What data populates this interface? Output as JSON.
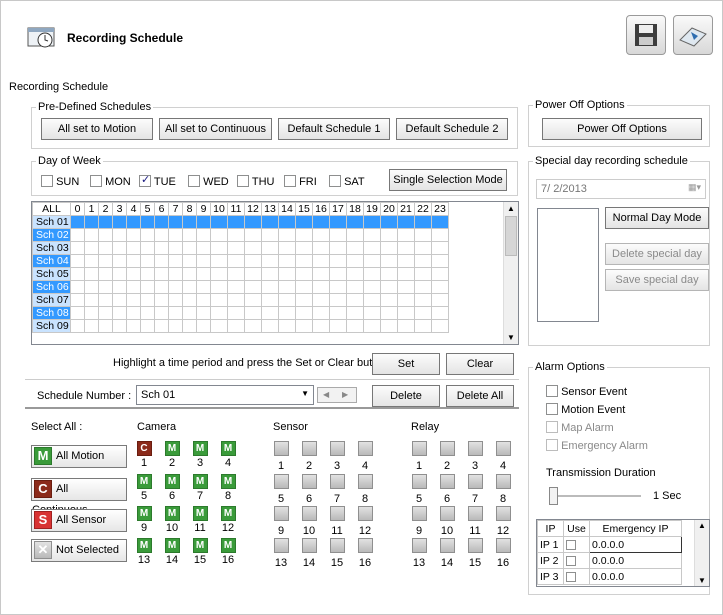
{
  "title": "Recording Schedule",
  "toolbar": {
    "save": "save-icon",
    "apply": "apply-icon"
  },
  "main_group": "Recording Schedule",
  "predefined": {
    "legend": "Pre-Defined Schedules",
    "buttons": [
      "All set to Motion",
      "All set to Continuous",
      "Default Schedule 1",
      "Default Schedule 2"
    ]
  },
  "dow": {
    "legend": "Day of Week",
    "days": [
      {
        "label": "SUN",
        "checked": false
      },
      {
        "label": "MON",
        "checked": false
      },
      {
        "label": "TUE",
        "checked": true
      },
      {
        "label": "WED",
        "checked": false
      },
      {
        "label": "THU",
        "checked": false
      },
      {
        "label": "FRI",
        "checked": false
      },
      {
        "label": "SAT",
        "checked": false
      }
    ],
    "mode_button": "Single Selection Mode"
  },
  "grid": {
    "all": "ALL",
    "hours": [
      "0",
      "1",
      "2",
      "3",
      "4",
      "5",
      "6",
      "7",
      "8",
      "9",
      "10",
      "11",
      "12",
      "13",
      "14",
      "15",
      "16",
      "17",
      "18",
      "19",
      "20",
      "21",
      "22",
      "23"
    ],
    "rows": [
      "Sch 01",
      "Sch 02",
      "Sch 03",
      "Sch 04",
      "Sch 05",
      "Sch 06",
      "Sch 07",
      "Sch 08",
      "Sch 09"
    ],
    "colors": {
      "selected_row": "#3399ff",
      "header_blue": "#5b9bd5"
    }
  },
  "hint": "Highlight a time period and press the Set or Clear button",
  "set_button": "Set",
  "clear_button": "Clear",
  "schedule_number": {
    "label": "Schedule Number :",
    "value": "Sch 01",
    "delete": "Delete",
    "delete_all": "Delete All"
  },
  "select_all": {
    "label": "Select All :",
    "buttons": [
      {
        "badge": "M",
        "label": "All Motion"
      },
      {
        "badge": "C",
        "label": "All Continuous"
      },
      {
        "badge": "S",
        "label": "All Sensor"
      },
      {
        "badge": "✕",
        "label": "Not Selected"
      }
    ]
  },
  "camera": {
    "label": "Camera",
    "badges": [
      "C",
      "M",
      "M",
      "M",
      "M",
      "M",
      "M",
      "M",
      "M",
      "M",
      "M",
      "M",
      "M",
      "M",
      "M",
      "M"
    ]
  },
  "sensor": {
    "label": "Sensor"
  },
  "relay": {
    "label": "Relay"
  },
  "numbers": [
    "1",
    "2",
    "3",
    "4",
    "5",
    "6",
    "7",
    "8",
    "9",
    "10",
    "11",
    "12",
    "13",
    "14",
    "15",
    "16"
  ],
  "power_off": {
    "legend": "Power Off Options",
    "button": "Power Off Options"
  },
  "special_day": {
    "legend": "Special day recording schedule",
    "date": "7/ 2/2013",
    "normal": "Normal Day Mode",
    "delete": "Delete special day",
    "save": "Save special day"
  },
  "alarm": {
    "legend": "Alarm Options",
    "items": [
      {
        "label": "Sensor Event",
        "enabled": true
      },
      {
        "label": "Motion Event",
        "enabled": true
      },
      {
        "label": "Map Alarm",
        "enabled": false
      },
      {
        "label": "Emergency Alarm",
        "enabled": false
      }
    ],
    "transmission_label": "Transmission Duration",
    "duration": "1 Sec"
  },
  "ip_table": {
    "headers": [
      "IP",
      "Use",
      "Emergency IP"
    ],
    "rows": [
      {
        "ip": "IP 1",
        "value": "0.0.0.0"
      },
      {
        "ip": "IP 2",
        "value": "0.0.0.0"
      },
      {
        "ip": "IP 3",
        "value": "0.0.0.0"
      }
    ]
  }
}
